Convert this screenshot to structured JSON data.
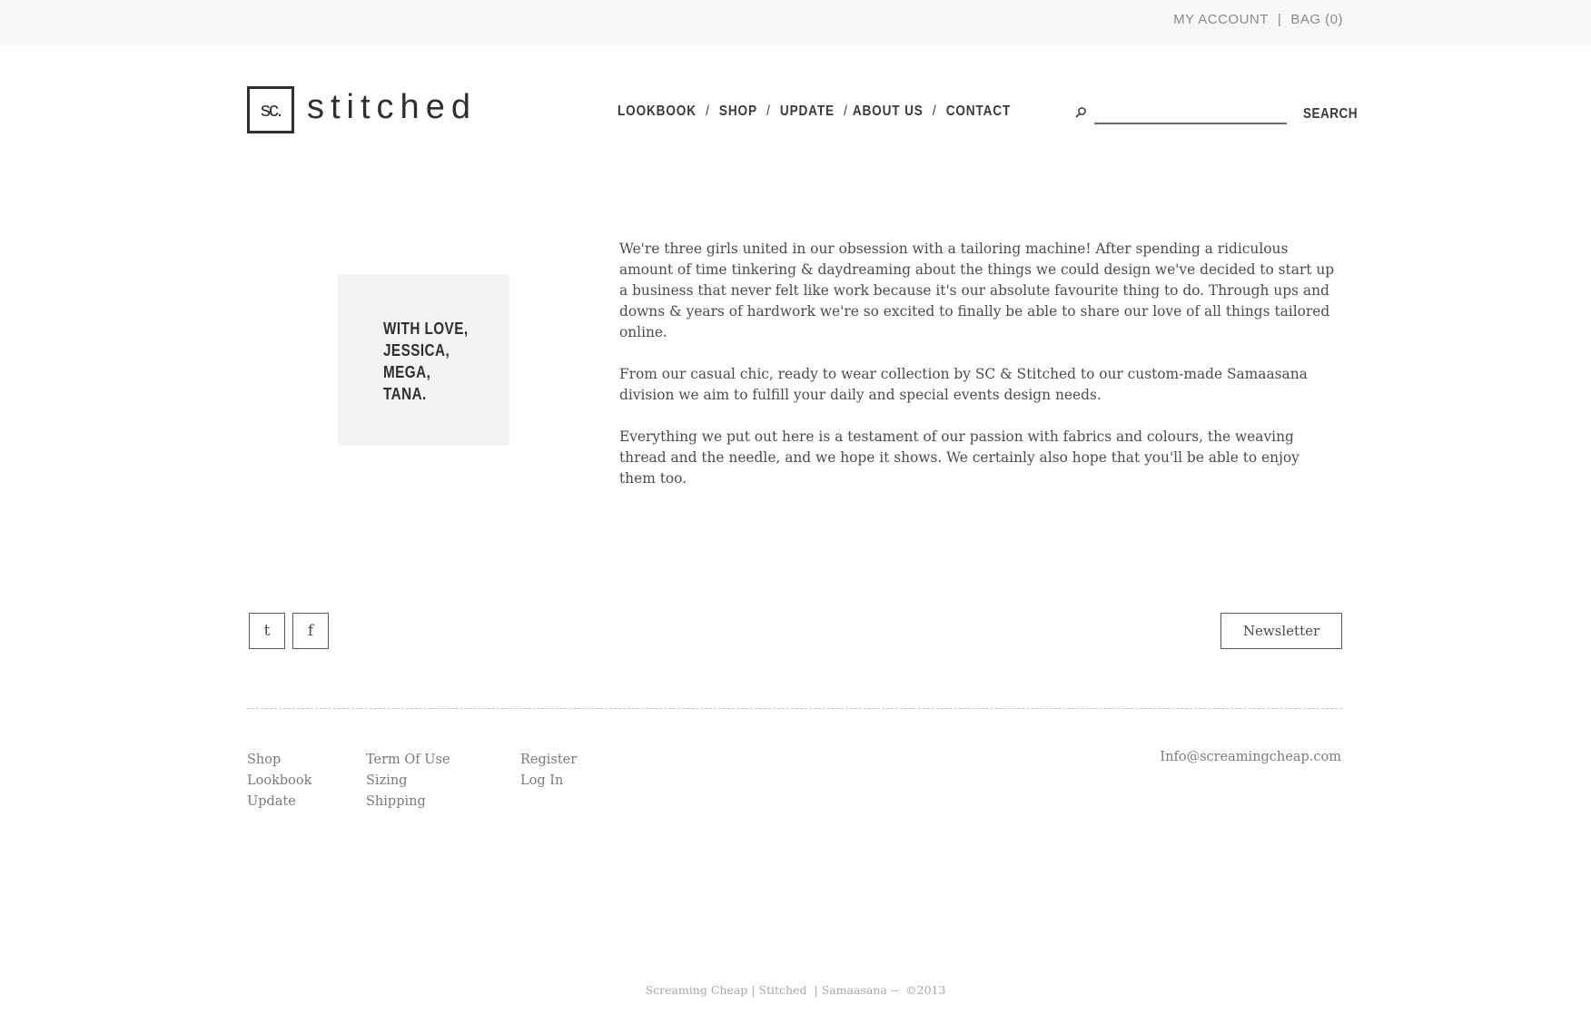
{
  "topbar": {
    "account_label": "MY ACCOUNT",
    "separator": "|",
    "bag_label": "BAG (0)"
  },
  "brand": {
    "mark": "sc.",
    "wordmark": "stitched"
  },
  "nav": {
    "items": [
      "LOOKBOOK",
      "SHOP",
      "UPDATE",
      "ABOUT US",
      "CONTACT"
    ],
    "separator": "/"
  },
  "search": {
    "placeholder": "",
    "value": "",
    "button_label": "SEARCH",
    "icon": "search-icon"
  },
  "signature": {
    "lines": [
      "WITH LOVE,",
      "JESSICA,",
      "MEGA,",
      "TANA."
    ]
  },
  "about": {
    "paragraphs": [
      "We're three girls united in our obsession with a tailoring machine! After spending a ridiculous amount of time tinkering & daydreaming about the things we could design we've decided to start up a business that never felt like work because it's our absolute favourite thing to do. Through ups and downs & years of hardwork we're so excited to finally be able to share our love of all things tailored online.",
      "From our casual chic, ready to wear collection by SC & Stitched to our custom-made Samaasana division we aim to fulfill your daily and special events design needs.",
      "Everything we put out here is a testament of our passion with fabrics and colours, the weaving thread and the needle, and we hope it shows. We certainly also hope that you'll be able to enjoy them too."
    ]
  },
  "social": {
    "twitter_label": "t",
    "facebook_label": "f"
  },
  "newsletter_label": "Newsletter",
  "footer": {
    "col1": [
      "Shop",
      "Lookbook",
      "Update"
    ],
    "col2": [
      "Term Of Use",
      "Sizing",
      "Shipping"
    ],
    "col3": [
      "Register",
      "Log In"
    ],
    "email": "Info@screamingcheap.com",
    "copyright": "Screaming Cheap | Stitched  | Samaasana --  ©2013"
  },
  "colors": {
    "topbar_bg": "#f6f7f6",
    "text": "#4a4a4a",
    "signature_bg": "#f3f3f3"
  }
}
